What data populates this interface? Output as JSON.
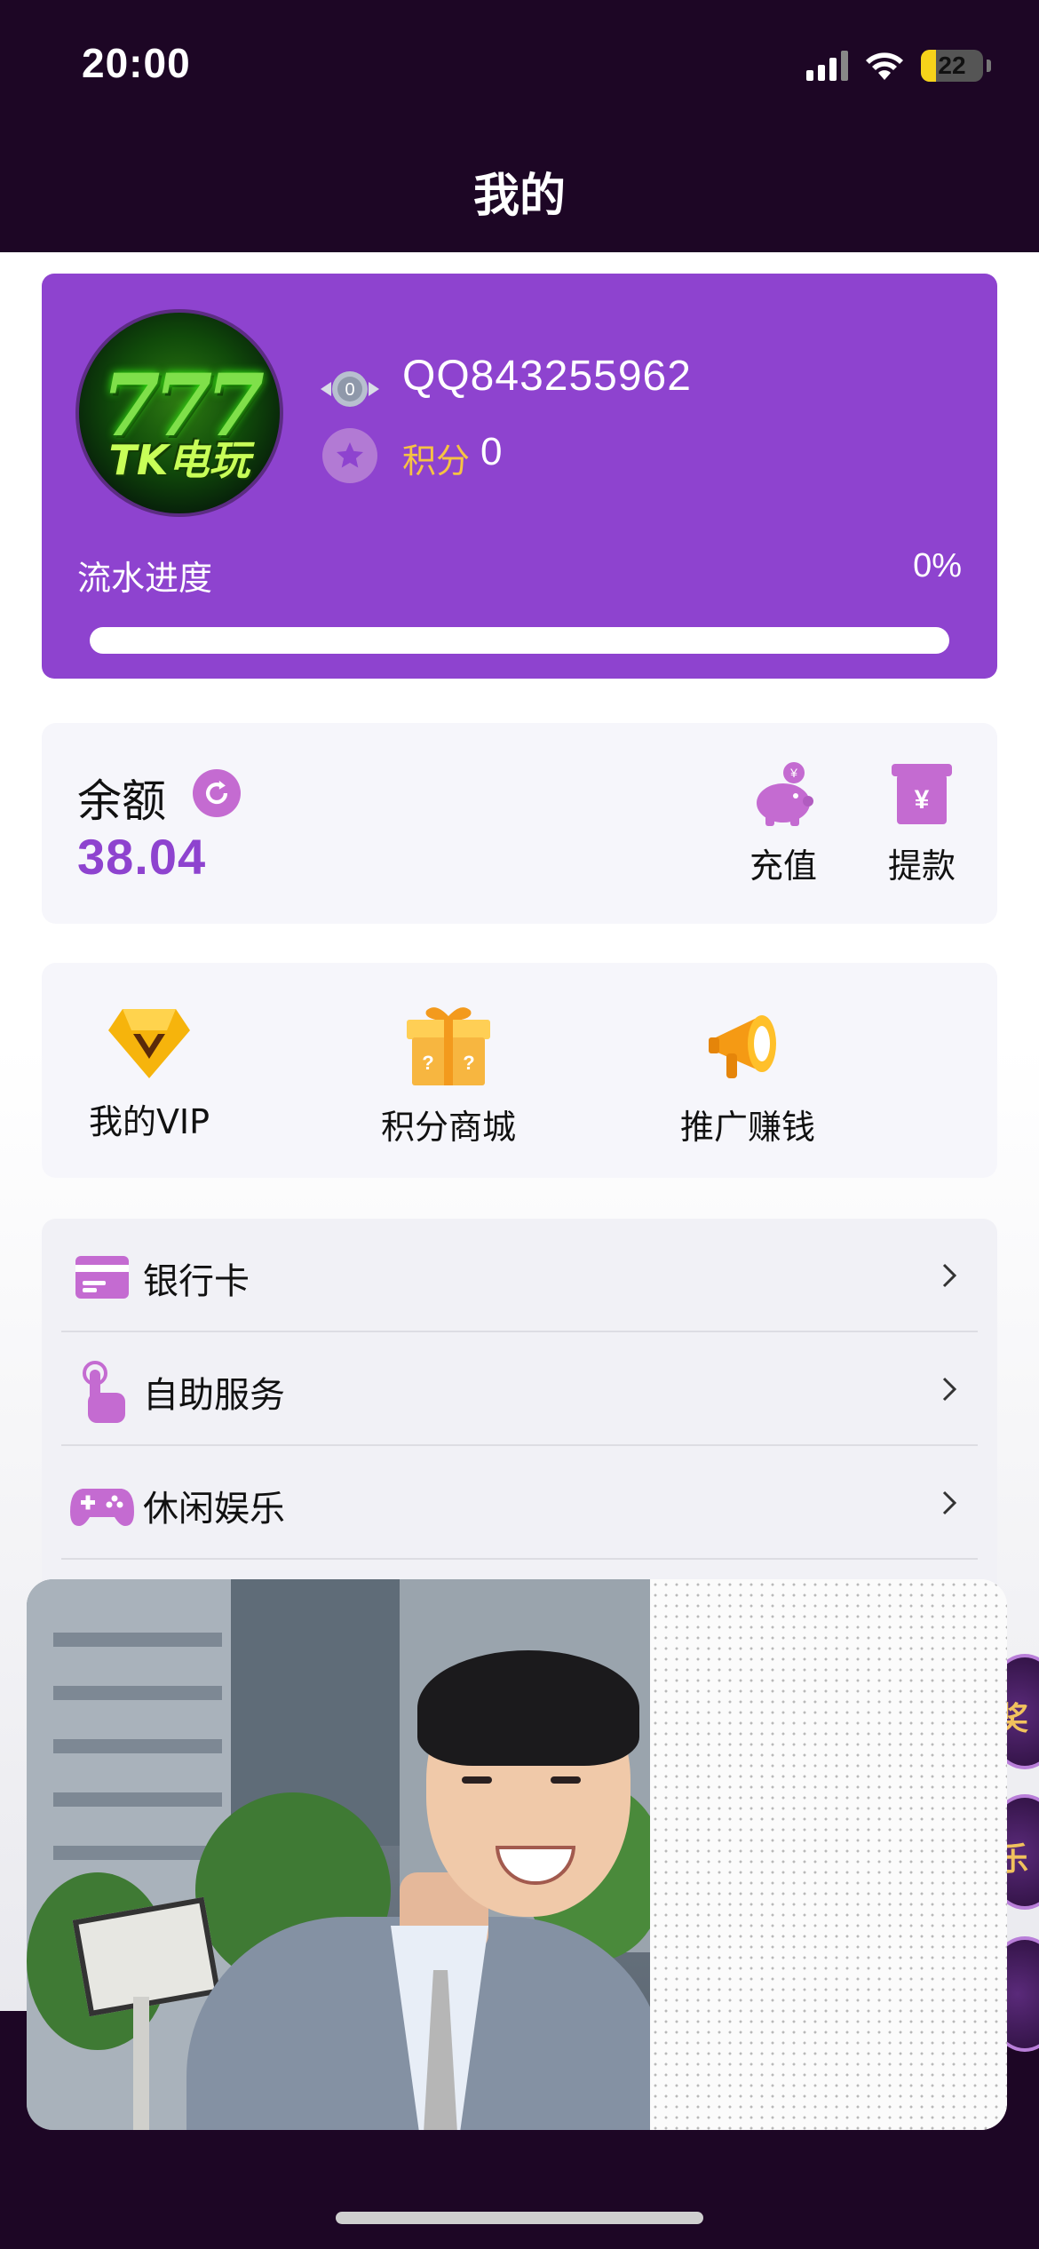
{
  "status_bar": {
    "time": "20:00",
    "battery": "22"
  },
  "header": {
    "title": "我的"
  },
  "profile": {
    "avatar_text": "TK电玩",
    "avatar_number": "777",
    "level": "0",
    "username": "QQ843255962",
    "points_label": "积分",
    "points_value": "0",
    "flow_label": "流水进度",
    "flow_percent": "0%",
    "flow_progress": 0
  },
  "balance": {
    "label": "余额",
    "value": "38.04",
    "recharge_label": "充值",
    "withdraw_label": "提款"
  },
  "features": [
    {
      "label": "我的VIP",
      "icon": "vip-diamond-icon"
    },
    {
      "label": "积分商城",
      "icon": "gift-box-icon"
    },
    {
      "label": "推广赚钱",
      "icon": "megaphone-icon"
    }
  ],
  "menu": [
    {
      "label": "银行卡",
      "icon": "bank-card-icon"
    },
    {
      "label": "自助服务",
      "icon": "hand-tap-icon"
    },
    {
      "label": "休闲娱乐",
      "icon": "gamepad-icon"
    }
  ],
  "side_floats": [
    "奖",
    "乐"
  ],
  "colors": {
    "primary": "#8e43cf",
    "accent": "#c46bd1",
    "header_bg": "#1d0625",
    "points": "#f6c342"
  }
}
